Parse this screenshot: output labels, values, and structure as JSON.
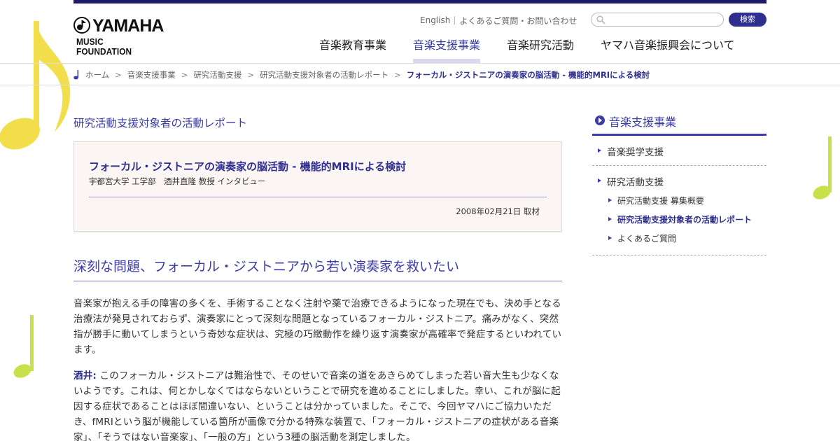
{
  "logo": {
    "line1": "YAMAHA",
    "line2": "MUSIC FOUNDATION"
  },
  "util_nav": {
    "english": "English",
    "faq": "よくあるご質問・お問い合わせ"
  },
  "search": {
    "placeholder": "",
    "button": "検索"
  },
  "main_nav": [
    {
      "label": "音楽教育事業",
      "active": false
    },
    {
      "label": "音楽支援事業",
      "active": true
    },
    {
      "label": "音楽研究活動",
      "active": false
    },
    {
      "label": "ヤマハ音楽振興会について",
      "active": false
    }
  ],
  "breadcrumb": {
    "items": [
      "ホーム",
      "音楽支援事業",
      "研究活動支援",
      "研究活動支援対象者の活動レポート"
    ],
    "separator": ">",
    "current": "フォーカル・ジストニアの演奏家の脳活動 - 機能的MRIによる検討"
  },
  "content": {
    "section_title": "研究活動支援対象者の活動レポート",
    "article": {
      "title": "フォーカル・ジストニアの演奏家の脳活動 - 機能的MRIによる検討",
      "subtitle": "宇都宮大学 工学部　酒井直隆 教授 インタビュー",
      "date": "2008年02月21日 取材"
    },
    "heading": "深刻な問題、フォーカル・ジストニアから若い演奏家を救いたい",
    "paragraph1": "音楽家が抱える手の障害の多くを、手術することなく注射や薬で治療できるようになった現在でも、決め手となる治療法が発見されておらず、演奏家にとって深刻な問題となっているフォーカル・ジストニア。痛みがなく、突然指が勝手に動いてしまうという奇妙な症状は、究極の巧緻動作を繰り返す演奏家が高確率で発症するといわれています。",
    "paragraph2_speaker": "酒井:",
    "paragraph2": " このフォーカル・ジストニアは難治性で、そのせいで音楽の道をあきらめてしまった若い音大生も少なくないようです。これは、何とかしなくてはならないということで研究を進めることにしました。幸い、これが脳に起因する症状であることはほぼ間違いない、ということは分かっていました。そこで、今回ヤマハにご協力いただき、fMRIという脳が機能している箇所が画像で分かる特殊な装置で、「フォーカル・ジストニアの症状がある音楽家」、「そうではない音楽家」、「一般の方」という3種の脳活動を測定しました。"
  },
  "sidebar": {
    "heading": "音楽支援事業",
    "items": [
      {
        "label": "音楽奨学支援"
      },
      {
        "label": "研究活動支援"
      }
    ],
    "sub_items": [
      {
        "label": "研究活動支援 募集概要",
        "current": false
      },
      {
        "label": "研究活動支援対象者の活動レポート",
        "current": true
      },
      {
        "label": "よくあるご質問",
        "current": false
      }
    ]
  },
  "colors": {
    "accent": "#3c3ca8",
    "top_bar": "#1d1b6b",
    "note_yellow": "#f2dd4a",
    "note_green": "#c9e04a"
  }
}
